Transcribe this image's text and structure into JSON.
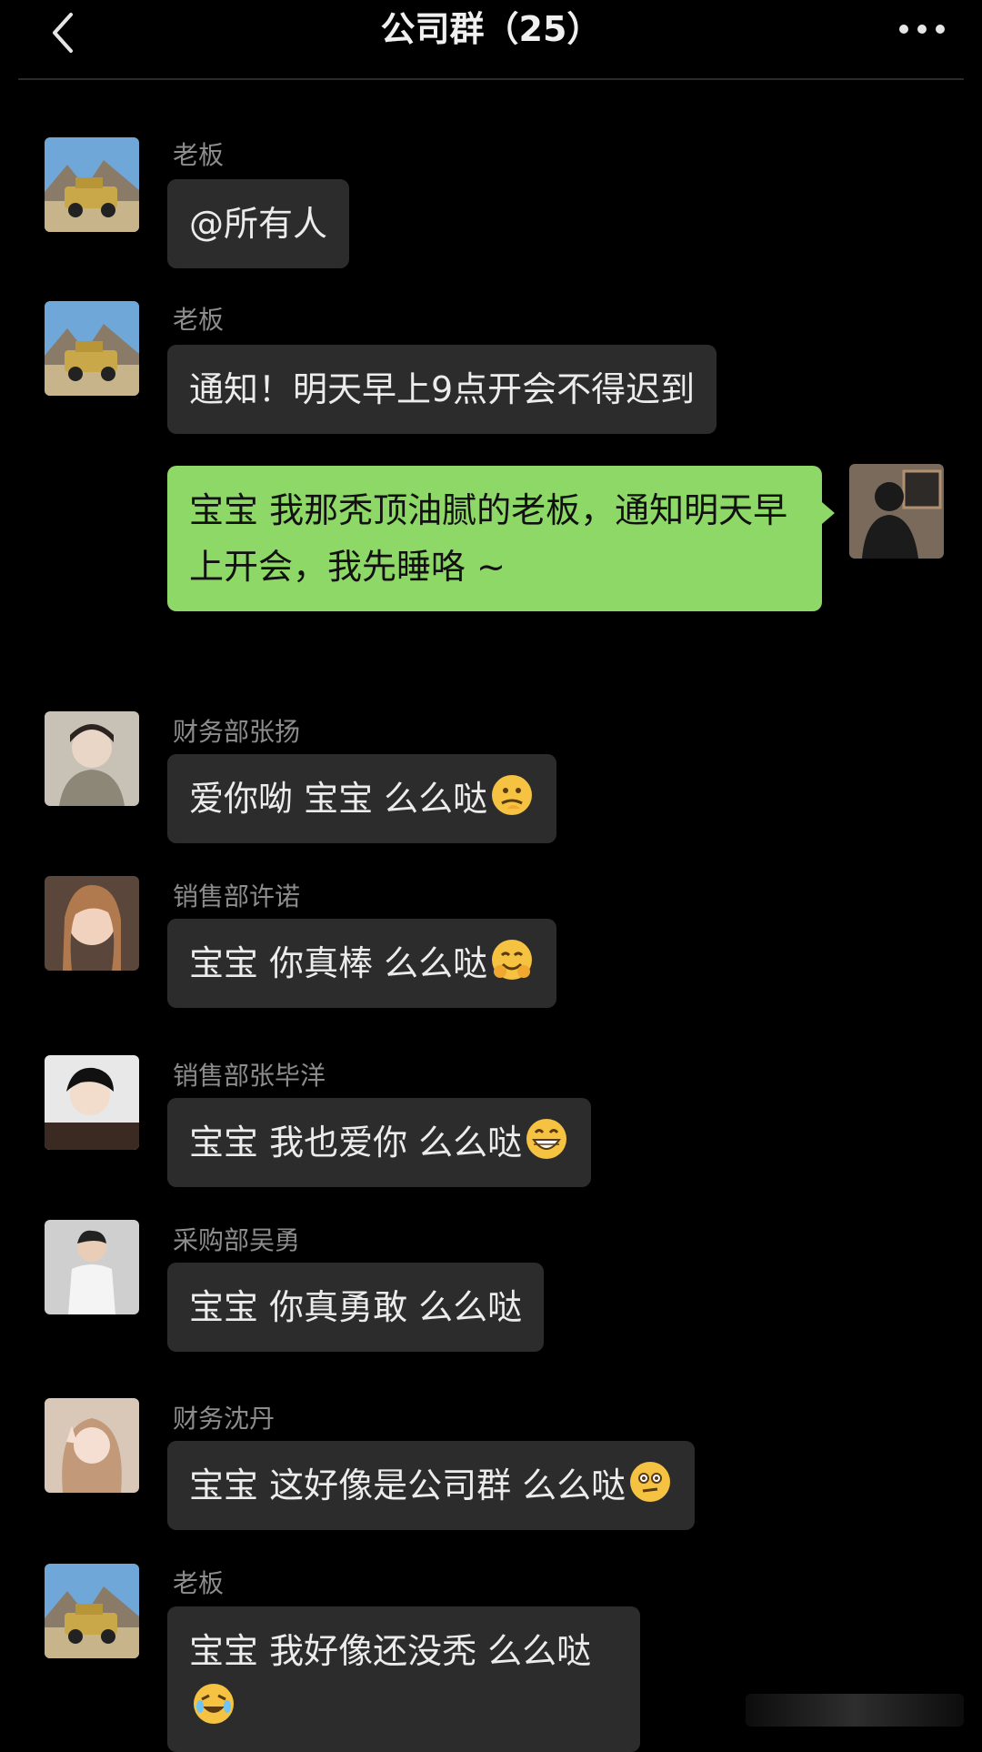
{
  "header": {
    "title": "公司群（25）"
  },
  "messages": [
    {
      "sender": "老板",
      "text": "@所有人",
      "avatar": "car-avatar"
    },
    {
      "sender": "老板",
      "text": "通知！明天早上9点开会不得迟到",
      "avatar": "car-avatar"
    },
    {
      "sender": "",
      "text": "宝宝 我那秃顶油腻的老板，通知明天早上开会，我先睡咯 ~",
      "avatar": "self-avatar",
      "mine": true
    },
    {
      "sender": "财务部张扬",
      "text": "爱你呦 宝宝 么么哒",
      "emoji": "thinking-face-emoji"
    },
    {
      "sender": "销售部许诺",
      "text": "宝宝 你真棒 么么哒",
      "emoji": "hugging-face-emoji"
    },
    {
      "sender": "销售部张毕洋",
      "text": "宝宝 我也爱你 么么哒",
      "emoji": "grinning-face-emoji"
    },
    {
      "sender": "采购部吴勇",
      "text": "宝宝 你真勇敢 么么哒"
    },
    {
      "sender": "财务沈丹",
      "text": "宝宝 这好像是公司群 么么哒",
      "emoji": "awkward-face-emoji"
    },
    {
      "sender": "老板",
      "text": "宝宝 我好像还没秃 么么哒",
      "emoji": "crying-laugh-emoji",
      "avatar": "car-avatar"
    }
  ],
  "colors": {
    "background": "#000000",
    "bubble_other": "#2c2c2c",
    "bubble_mine": "#8ed867",
    "sender_name": "#8c8c8c"
  }
}
